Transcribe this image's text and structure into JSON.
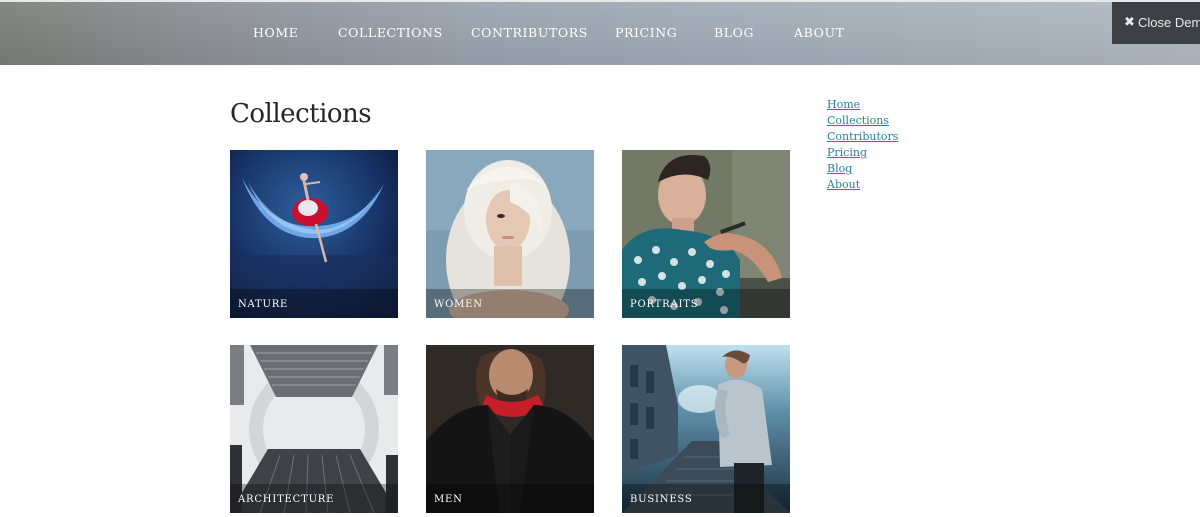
{
  "header": {
    "nav": [
      {
        "label": "HOME"
      },
      {
        "label": "COLLECTIONS"
      },
      {
        "label": "CONTRIBUTORS"
      },
      {
        "label": "PRICING"
      },
      {
        "label": "BLOG"
      },
      {
        "label": "ABOUT"
      }
    ],
    "close_demo": {
      "icon": "close-icon",
      "label": "Close Demo"
    }
  },
  "main": {
    "title": "Collections",
    "collections": [
      {
        "label": "NATURE"
      },
      {
        "label": "WOMEN"
      },
      {
        "label": "PORTRAITS"
      },
      {
        "label": "ARCHITECTURE"
      },
      {
        "label": "MEN"
      },
      {
        "label": "BUSINESS"
      }
    ]
  },
  "sidebar": {
    "links": [
      {
        "label": "Home"
      },
      {
        "label": "Collections"
      },
      {
        "label": "Contributors"
      },
      {
        "label": "Pricing"
      },
      {
        "label": "Blog"
      },
      {
        "label": "About"
      }
    ]
  },
  "colors": {
    "link": "#2a7fa3",
    "title": "#262626",
    "close_bg": "#3d4145"
  }
}
